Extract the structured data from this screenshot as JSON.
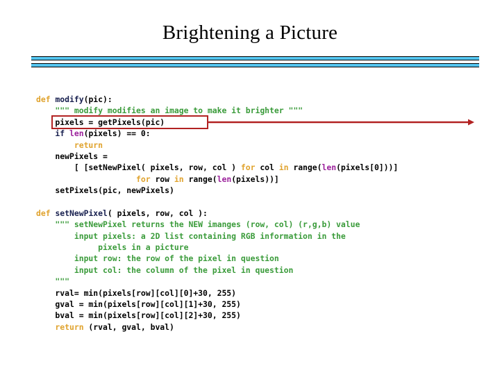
{
  "slide": {
    "title": "Brightening a Picture",
    "divider": {
      "bar_color": "#55C6F0",
      "border_color": "#000000"
    },
    "annotation": {
      "highlight_color": "#B22222",
      "arrow_color": "#B22222",
      "highlighted_text": "pixels = getPixels(pic)"
    }
  },
  "code": {
    "syntax_colors": {
      "keyword": "#E0A32E",
      "function_name": "#18204F",
      "docstring": "#3A9B3A",
      "builtin": "#9B209B",
      "plain": "#000000"
    },
    "lines": [
      {
        "id": "line-1",
        "indent": 0,
        "tokens": [
          {
            "t": "def ",
            "c": "kw"
          },
          {
            "t": "modify",
            "c": "fn"
          },
          {
            "t": "(pic):",
            "c": "pl"
          }
        ]
      },
      {
        "id": "line-2",
        "indent": 0,
        "tokens": [
          {
            "t": "    \"\"\" modify modifies an image to make it brighter \"\"\"",
            "c": "doc"
          }
        ]
      },
      {
        "id": "line-3",
        "indent": 0,
        "tokens": [
          {
            "t": "    pixels = getPixels(pic)",
            "c": "pl"
          }
        ]
      },
      {
        "id": "line-4",
        "indent": 0,
        "tokens": [
          {
            "t": "    if ",
            "c": "fn"
          },
          {
            "t": "len",
            "c": "bi"
          },
          {
            "t": "(pixels) == 0:",
            "c": "pl"
          }
        ]
      },
      {
        "id": "line-5",
        "indent": 0,
        "tokens": [
          {
            "t": "        return",
            "c": "kw"
          }
        ]
      },
      {
        "id": "line-6",
        "indent": 0,
        "tokens": [
          {
            "t": "    newPixels =",
            "c": "pl"
          }
        ]
      },
      {
        "id": "line-7",
        "indent": 0,
        "tokens": [
          {
            "t": "        [ [setNewPixel( pixels, row, col ) ",
            "c": "pl"
          },
          {
            "t": "for",
            "c": "kw"
          },
          {
            "t": " col ",
            "c": "pl"
          },
          {
            "t": "in",
            "c": "kw"
          },
          {
            "t": " range(",
            "c": "pl"
          },
          {
            "t": "len",
            "c": "bi"
          },
          {
            "t": "(pixels[0]))]",
            "c": "pl"
          }
        ]
      },
      {
        "id": "line-8",
        "indent": 0,
        "tokens": [
          {
            "t": "                     ",
            "c": "pl"
          },
          {
            "t": "for",
            "c": "kw"
          },
          {
            "t": " row ",
            "c": "pl"
          },
          {
            "t": "in",
            "c": "kw"
          },
          {
            "t": " range(",
            "c": "pl"
          },
          {
            "t": "len",
            "c": "bi"
          },
          {
            "t": "(pixels))]",
            "c": "pl"
          }
        ]
      },
      {
        "id": "line-9",
        "indent": 0,
        "tokens": [
          {
            "t": "    setPixels(pic, newPixels)",
            "c": "pl"
          }
        ]
      },
      {
        "id": "line-10",
        "indent": 0,
        "tokens": [
          {
            "t": " ",
            "c": "pl"
          }
        ]
      },
      {
        "id": "line-11",
        "indent": 0,
        "tokens": [
          {
            "t": "def ",
            "c": "kw"
          },
          {
            "t": "setNewPixel",
            "c": "fn"
          },
          {
            "t": "( pixels, row, col ):",
            "c": "pl"
          }
        ]
      },
      {
        "id": "line-12",
        "indent": 0,
        "tokens": [
          {
            "t": "    \"\"\" setNewPixel returns the NEW imanges (row, col) (r,g,b) value",
            "c": "doc"
          }
        ]
      },
      {
        "id": "line-13",
        "indent": 0,
        "tokens": [
          {
            "t": "        input pixels: a 2D list containing RGB information in the",
            "c": "doc"
          }
        ]
      },
      {
        "id": "line-14",
        "indent": 0,
        "tokens": [
          {
            "t": "             pixels in a picture",
            "c": "doc"
          }
        ]
      },
      {
        "id": "line-15",
        "indent": 0,
        "tokens": [
          {
            "t": "        input row: the row of the pixel in question",
            "c": "doc"
          }
        ]
      },
      {
        "id": "line-16",
        "indent": 0,
        "tokens": [
          {
            "t": "        input col: the column of the pixel in question",
            "c": "doc"
          }
        ]
      },
      {
        "id": "line-17",
        "indent": 0,
        "tokens": [
          {
            "t": "    \"\"\"",
            "c": "doc"
          }
        ]
      },
      {
        "id": "line-18",
        "indent": 0,
        "tokens": [
          {
            "t": "    rval= min(pixels[row][col][0]+30, 255)",
            "c": "pl"
          }
        ]
      },
      {
        "id": "line-19",
        "indent": 0,
        "tokens": [
          {
            "t": "    gval = min(pixels[row][col][1]+30, 255)",
            "c": "pl"
          }
        ]
      },
      {
        "id": "line-20",
        "indent": 0,
        "tokens": [
          {
            "t": "    bval = min(pixels[row][col][2]+30, 255)",
            "c": "pl"
          }
        ]
      },
      {
        "id": "line-21",
        "indent": 0,
        "tokens": [
          {
            "t": "    return",
            "c": "kw"
          },
          {
            "t": " (rval, gval, bval)",
            "c": "pl"
          }
        ]
      }
    ]
  }
}
